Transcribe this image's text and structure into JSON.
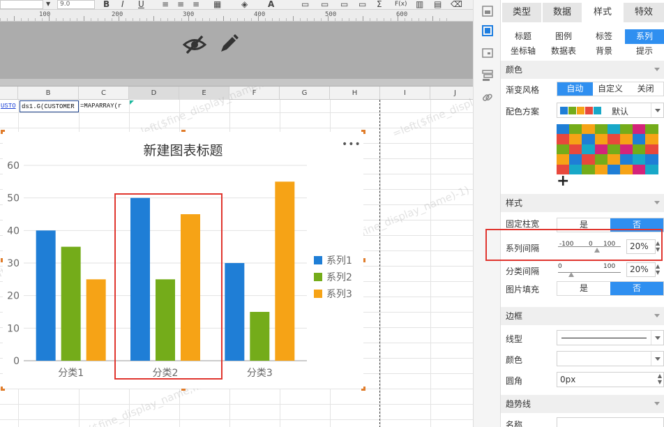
{
  "toolbar": {
    "font_size": "9.0"
  },
  "ruler": {
    "labels": [
      "100",
      "200",
      "300",
      "400",
      "500",
      "600"
    ]
  },
  "grid": {
    "columns": [
      "B",
      "C",
      "D",
      "E",
      "F",
      "G",
      "H",
      "I",
      "J"
    ],
    "cells": {
      "a1": "USTO",
      "b1": "ds1.G(CUSTOMER",
      "c1": "=MAPARRAY(r"
    },
    "watermark_text": "=left($fine_display_name,find(\"(\",$fine_display_name)-1)"
  },
  "chart_data": {
    "type": "bar",
    "title": "新建图表标题",
    "more_label": "•••",
    "categories": [
      "分类1",
      "分类2",
      "分类3"
    ],
    "y_ticks": [
      "0",
      "10",
      "20",
      "30",
      "40",
      "50",
      "60"
    ],
    "ylim": [
      0,
      60
    ],
    "grid": true,
    "legend_position": "right",
    "series": [
      {
        "name": "系列1",
        "values": [
          40,
          50,
          30
        ],
        "color": "#1f7ed6"
      },
      {
        "name": "系列2",
        "values": [
          35,
          25,
          15
        ],
        "color": "#74ac1a"
      },
      {
        "name": "系列3",
        "values": [
          25,
          45,
          55
        ],
        "color": "#f6a316"
      }
    ]
  },
  "panel": {
    "tabs": [
      {
        "label": "类型",
        "active": false
      },
      {
        "label": "数据",
        "active": false
      },
      {
        "label": "样式",
        "active": true
      },
      {
        "label": "特效",
        "active": false
      }
    ],
    "subtabs": [
      {
        "label": "标题",
        "active": false
      },
      {
        "label": "图例",
        "active": false
      },
      {
        "label": "标签",
        "active": false
      },
      {
        "label": "系列",
        "active": true
      },
      {
        "label": "坐标轴",
        "active": false
      },
      {
        "label": "数据表",
        "active": false
      },
      {
        "label": "背景",
        "active": false
      },
      {
        "label": "提示",
        "active": false
      }
    ],
    "color_section": {
      "title": "颜色",
      "gradient_label": "渐变风格",
      "gradient_options": [
        "自动",
        "自定义",
        "关闭"
      ],
      "gradient_selected": 0,
      "scheme_label": "配色方案",
      "scheme_value": "默认",
      "scheme_swatches": [
        "#1f7ed6",
        "#74ac1a",
        "#f6a316",
        "#e8483c",
        "#18a8c8"
      ],
      "palette": [
        [
          "#1f7ed6",
          "#74ac1a",
          "#f6a316",
          "#74ac1a",
          "#18a8c8",
          "#74ac1a",
          "#d4247a",
          "#74ac1a"
        ],
        [
          "#e8483c",
          "#f6a316",
          "#1f7ed6",
          "#f6a316",
          "#e8483c",
          "#f6a316",
          "#1f7ed6",
          "#f6a316"
        ],
        [
          "#74ac1a",
          "#e8483c",
          "#18a8c8",
          "#d4247a",
          "#74ac1a",
          "#d4247a",
          "#74ac1a",
          "#e8483c"
        ],
        [
          "#f6a316",
          "#1f7ed6",
          "#e8483c",
          "#74ac1a",
          "#f6a316",
          "#1f7ed6",
          "#18a8c8",
          "#1f7ed6"
        ],
        [
          "#e8483c",
          "#18a8c8",
          "#74ac1a",
          "#f6a316",
          "#1f7ed6",
          "#f6a316",
          "#d4247a",
          "#18a8c8"
        ]
      ],
      "add_label": "+"
    },
    "style_section": {
      "title": "样式",
      "fixed_width_label": "固定柱宽",
      "yes": "是",
      "no": "否",
      "series_gap_label": "系列间隔",
      "series_gap_min": "-100",
      "series_gap_mid": "0",
      "series_gap_max": "100",
      "series_gap_value": "20%",
      "category_gap_label": "分类间隔",
      "category_gap_min": "0",
      "category_gap_max": "100",
      "category_gap_value": "20%",
      "image_fill_label": "图片填充"
    },
    "border_section": {
      "title": "边框",
      "line_type_label": "线型",
      "color_label": "颜色",
      "radius_label": "圆角",
      "radius_value": "0px"
    },
    "trend_section": {
      "title": "趋势线",
      "name_label": "名称"
    }
  }
}
